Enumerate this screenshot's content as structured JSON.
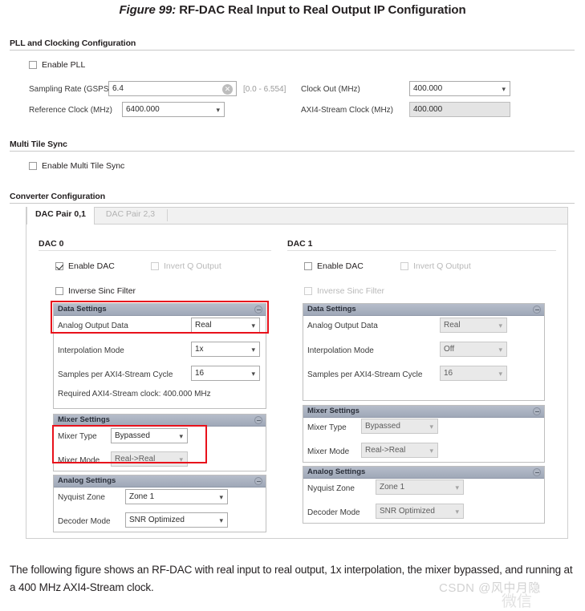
{
  "figure": {
    "number": "Figure 99:",
    "title": "RF-DAC Real Input to Real Output IP Configuration"
  },
  "pll_section": {
    "heading": "PLL and Clocking Configuration",
    "enable_pll": {
      "label": "Enable PLL",
      "checked": false
    },
    "sampling_rate": {
      "label": "Sampling Rate (GSPS)",
      "value": "6.4",
      "range_hint": "[0.0 - 6.554]",
      "clear_icon": "clear-icon"
    },
    "reference_clock": {
      "label": "Reference Clock (MHz)",
      "value": "6400.000"
    },
    "clock_out": {
      "label": "Clock Out (MHz)",
      "value": "400.000"
    },
    "axi_stream_clock": {
      "label": "AXI4-Stream Clock (MHz)",
      "value": "400.000"
    }
  },
  "mts_section": {
    "heading": "Multi Tile Sync",
    "enable_mts": {
      "label": "Enable Multi Tile Sync",
      "checked": false
    }
  },
  "converter_section": {
    "heading": "Converter Configuration",
    "tabs": [
      {
        "label": "DAC Pair 0,1",
        "active": true
      },
      {
        "label": "DAC Pair 2,3",
        "active": false
      }
    ]
  },
  "dac0": {
    "heading": "DAC 0",
    "enable_dac": {
      "label": "Enable DAC",
      "checked": true,
      "disabled": false
    },
    "invert_q": {
      "label": "Invert Q Output",
      "checked": false,
      "disabled": true
    },
    "inverse_sinc": {
      "label": "Inverse Sinc Filter",
      "checked": false,
      "disabled": false
    },
    "data_settings": {
      "title": "Data Settings",
      "collapse_icon": "collapse-icon",
      "analog_output_data": {
        "label": "Analog Output Data",
        "value": "Real",
        "disabled": false
      },
      "interpolation_mode": {
        "label": "Interpolation Mode",
        "value": "1x",
        "disabled": false
      },
      "samples_per_cycle": {
        "label": "Samples per AXI4-Stream Cycle",
        "value": "16",
        "disabled": false
      },
      "required_clock": "Required AXI4-Stream clock: 400.000 MHz"
    },
    "mixer_settings": {
      "title": "Mixer Settings",
      "collapse_icon": "collapse-icon",
      "mixer_type": {
        "label": "Mixer Type",
        "value": "Bypassed",
        "disabled": false
      },
      "mixer_mode": {
        "label": "Mixer Mode",
        "value": "Real->Real",
        "disabled": true
      }
    },
    "analog_settings": {
      "title": "Analog Settings",
      "collapse_icon": "collapse-icon",
      "nyquist_zone": {
        "label": "Nyquist Zone",
        "value": "Zone 1",
        "disabled": false
      },
      "decoder_mode": {
        "label": "Decoder Mode",
        "value": "SNR Optimized",
        "disabled": false
      }
    }
  },
  "dac1": {
    "heading": "DAC 1",
    "enable_dac": {
      "label": "Enable DAC",
      "checked": false,
      "disabled": false
    },
    "invert_q": {
      "label": "Invert Q Output",
      "checked": false,
      "disabled": true
    },
    "inverse_sinc": {
      "label": "Inverse Sinc Filter",
      "checked": false,
      "disabled": true
    },
    "data_settings": {
      "title": "Data Settings",
      "collapse_icon": "collapse-icon",
      "analog_output_data": {
        "label": "Analog Output Data",
        "value": "Real",
        "disabled": true
      },
      "interpolation_mode": {
        "label": "Interpolation Mode",
        "value": "Off",
        "disabled": true
      },
      "samples_per_cycle": {
        "label": "Samples per AXI4-Stream Cycle",
        "value": "16",
        "disabled": true
      }
    },
    "mixer_settings": {
      "title": "Mixer Settings",
      "collapse_icon": "collapse-icon",
      "mixer_type": {
        "label": "Mixer Type",
        "value": "Bypassed",
        "disabled": true
      },
      "mixer_mode": {
        "label": "Mixer Mode",
        "value": "Real->Real",
        "disabled": true
      }
    },
    "analog_settings": {
      "title": "Analog Settings",
      "collapse_icon": "collapse-icon",
      "nyquist_zone": {
        "label": "Nyquist Zone",
        "value": "Zone 1",
        "disabled": true
      },
      "decoder_mode": {
        "label": "Decoder Mode",
        "value": "SNR Optimized",
        "disabled": true
      }
    }
  },
  "caption": "The following figure shows an RF-DAC with real input to real output, 1x interpolation, the mixer bypassed, and running at a 400 MHz AXI4-Stream clock.",
  "watermark": {
    "line1": "CSDN @风中月隐",
    "line2": "微信"
  },
  "colors": {
    "highlight": "#e8111b",
    "panel_header": "#a8b0c0",
    "text": "#231f20"
  }
}
